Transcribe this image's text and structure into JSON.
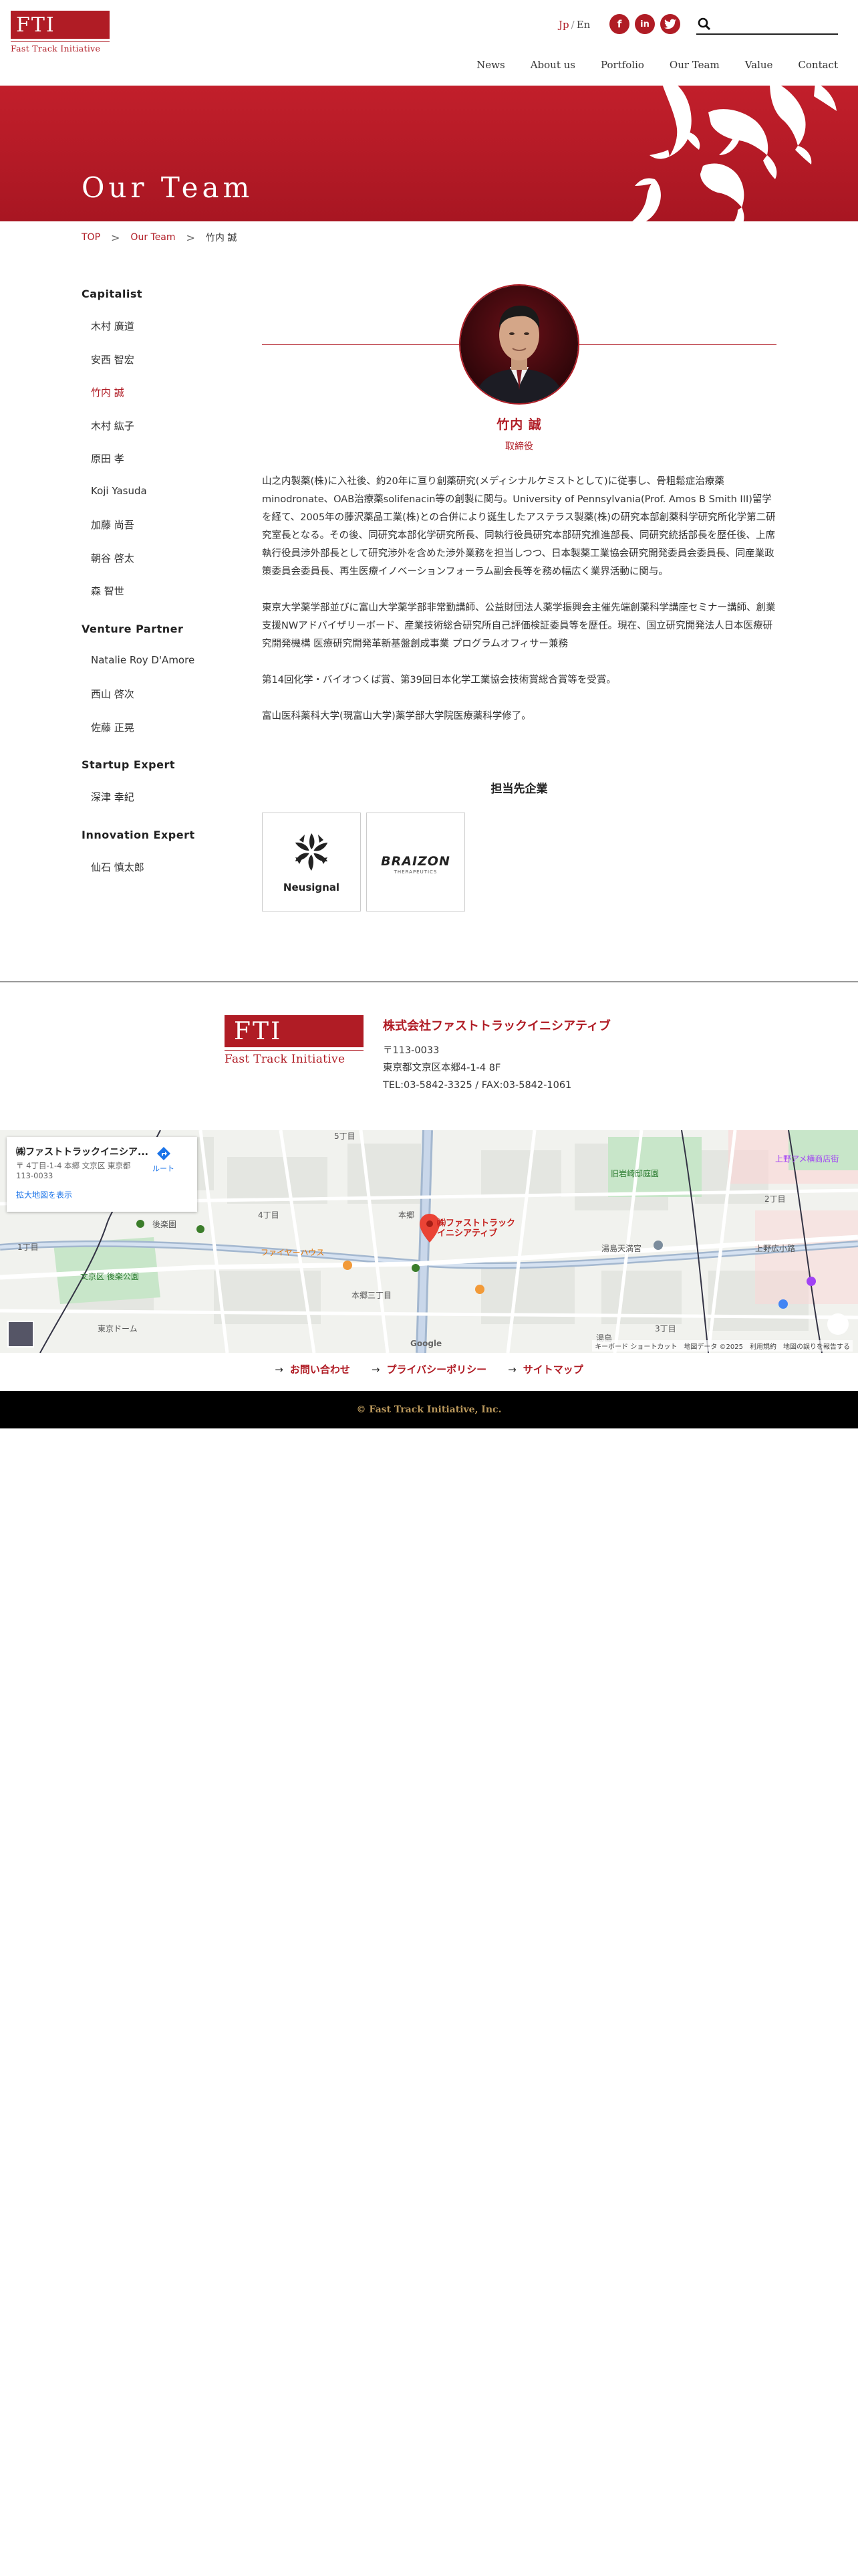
{
  "header": {
    "logo_text": "FTI",
    "logo_subtext": "Fast Track Initiative",
    "lang_active": "Jp",
    "lang_sep": "/",
    "lang_other": "En",
    "social": [
      "f",
      "in",
      "t"
    ],
    "search_placeholder": "",
    "nav": [
      "News",
      "About us",
      "Portfolio",
      "Our Team",
      "Value",
      "Contact"
    ]
  },
  "hero": {
    "title": "Our Team"
  },
  "breadcrumb": {
    "home": "TOP",
    "parent": "Our Team",
    "current": "竹内 誠"
  },
  "sidebar": {
    "groups": [
      {
        "label": "Capitalist",
        "members": [
          "木村 廣道",
          "安西 智宏",
          "竹内 誠",
          "木村 紘子",
          "原田 孝",
          "Koji Yasuda",
          "加藤 尚吾",
          "朝谷 啓太",
          "森 智世"
        ]
      },
      {
        "label": "Venture Partner",
        "members": [
          "Natalie Roy D'Amore",
          "西山 啓次",
          "佐藤 正晃"
        ]
      },
      {
        "label": "Startup Expert",
        "members": [
          "深津 幸紀"
        ]
      },
      {
        "label": "Innovation Expert",
        "members": [
          "仙石 慎太郎"
        ]
      }
    ],
    "active_member": "竹内 誠"
  },
  "profile": {
    "name": "竹内 誠",
    "title": "取締役",
    "bio": [
      "山之内製薬(株)に入社後、約20年に亘り創薬研究(メディシナルケミストとして)に従事し、骨粗鬆症治療薬minodronate、OAB治療薬solifenacin等の創製に関与。University of Pennsylvania(Prof. Amos B Smith III)留学を経て、2005年の藤沢薬品工業(株)との合併により誕生したアステラス製薬(株)の研究本部創薬科学研究所化学第二研究室長となる。その後、同研究本部化学研究所長、同執行役員研究本部研究推進部長、同研究統括部長を歴任後、上席執行役員渉外部長として研究渉外を含めた渉外業務を担当しつつ、日本製薬工業協会研究開発委員会委員長、同産業政策委員会委員長、再生医療イノベーションフォーラム副会長等を務め幅広く業界活動に関与。",
      "東京大学薬学部並びに富山大学薬学部非常勤講師、公益財団法人薬学振興会主催先端創薬科学講座セミナー講師、創業支援NWアドバイザリーボード、産業技術総合研究所自己評価検証委員等を歴任。現在、国立研究開発法人日本医療研究開発機構 医療研究開発革新基盤創成事業 プログラムオフィサー兼務",
      "第14回化学・バイオつくば賞、第39回日本化学工業協会技術賞総合賞等を受賞。",
      "富山医科薬科大学(現富山大学)薬学部大学院医療薬科学修了。"
    ],
    "portfolio_heading": "担当先企業",
    "companies": [
      {
        "name": "Neusignal"
      },
      {
        "name": "BRAIZON",
        "sub": "THERAPEUTICS"
      }
    ]
  },
  "footer": {
    "logo_text": "FTI",
    "logo_subtext": "Fast Track Initiative",
    "company": "株式会社ファストトラックイニシアティブ",
    "postal": "〒113-0033",
    "address": "東京都文京区本郷4-1-4 8F",
    "tel": "TEL:03-5842-3325 / FAX:03-5842-1061",
    "links": [
      "お問い合わせ",
      "プライバシーポリシー",
      "サイトマップ"
    ],
    "copyright": "© Fast Track Initiative, Inc."
  },
  "map": {
    "card_title": "㈱ファストトラックイニシア...",
    "card_address": "〒 4丁目-1-4 本郷 文京区 東京都 113-0033",
    "card_link": "拡大地図を表示",
    "route": "ルート",
    "pin_label_1": "㈱ファストトラック",
    "pin_label_2": "イニシアティブ",
    "labels": [
      "後楽園",
      "文京区 後楽公園",
      "東京ドーム",
      "本郷三丁目",
      "湯島",
      "上野広小路",
      "湯島天満宮",
      "本郷",
      "4丁目",
      "3丁目",
      "1丁目",
      "2丁目",
      "5丁目",
      "ファイヤーハウス",
      "上野アメ横商店街",
      "旧岩崎邸庭園"
    ],
    "attribution": "キーボード ショートカット　地図データ ©2025　利用規約　地図の誤りを報告する",
    "google": "Google"
  },
  "colors": {
    "brand": "#b01c25",
    "hero": "#c21f2b",
    "gold": "#b9975b"
  }
}
